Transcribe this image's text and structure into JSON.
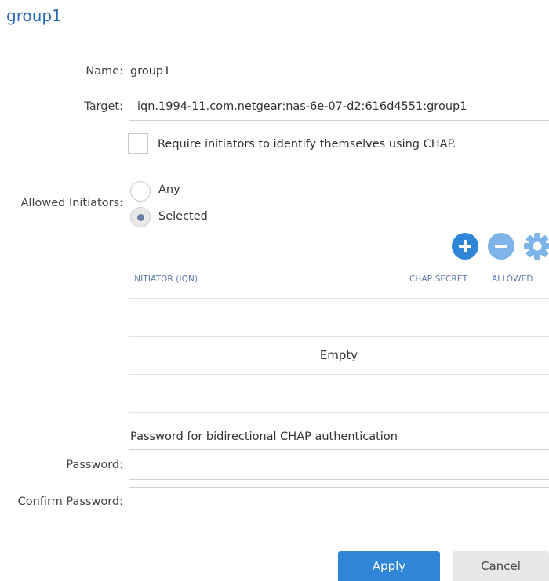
{
  "dialog": {
    "title": "group1"
  },
  "name": {
    "label": "Name:",
    "value": "group1"
  },
  "target": {
    "label": "Target:",
    "value": "iqn.1994-11.com.netgear:nas-6e-07-d2:616d4551:group1"
  },
  "chap": {
    "checkbox_label": "Require initiators to identify themselves using CHAP.",
    "checked": false
  },
  "allowed_initiators": {
    "label": "Allowed Initiators:",
    "options": [
      {
        "label": "Any",
        "selected": false
      },
      {
        "label": "Selected",
        "selected": true
      }
    ]
  },
  "toolbar": {
    "icons": [
      "plus-icon",
      "minus-icon",
      "gear-icon"
    ],
    "accent": "#2f86d9"
  },
  "initiator_table": {
    "columns": [
      "INITIATOR (IQN)",
      "CHAP SECRET",
      "ALLOWED"
    ],
    "rows": [],
    "empty_text": "Empty"
  },
  "bidirectional": {
    "heading": "Password for bidirectional CHAP authentication",
    "password_label": "Password:",
    "confirm_label": "Confirm Password:"
  },
  "buttons": {
    "apply": "Apply",
    "cancel": "Cancel"
  }
}
